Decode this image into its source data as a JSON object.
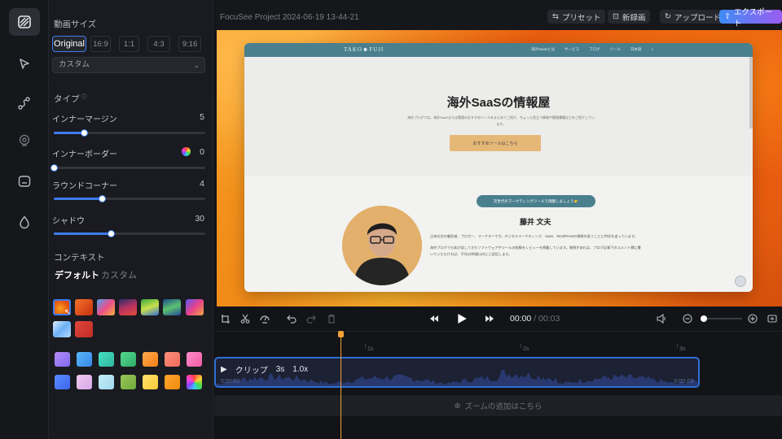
{
  "sidebar": {
    "icons": [
      "gradient-background-icon",
      "cursor-icon",
      "path-motion-icon",
      "camera-icon",
      "caption-icon",
      "drop-icon"
    ]
  },
  "settings": {
    "video_size_title": "動画サイズ",
    "ratios": [
      "Original",
      "16:9",
      "1:1",
      "4:3",
      "9:16"
    ],
    "size_select": "カスタム",
    "type_title": "タイプ",
    "inner_margin": {
      "label": "インナーマージン",
      "value": "5",
      "level": 0.2
    },
    "inner_border": {
      "label": "インナーボーダー",
      "value": "0",
      "level": 0.0
    },
    "round_corner": {
      "label": "ラウンドコーナー",
      "value": "4",
      "level": 0.32
    },
    "shadow": {
      "label": "シャドウ",
      "value": "30",
      "level": 0.38
    },
    "context_title": "コンテキスト",
    "tab_default": "デフォルト",
    "tab_custom": "カスタム"
  },
  "header": {
    "project_title": "FocuSee Project 2024-06-19 13-44-21",
    "preset": "プリセット",
    "new_recording": "新録画",
    "upload": "アップロード",
    "export": "エクスポート"
  },
  "website": {
    "logo": "TAKO☻FUJI",
    "nav": [
      "海外SaaSとは",
      "サービス",
      "ブログ",
      "ツール",
      "日本語"
    ],
    "hero_title": "海外SaaSの情報屋",
    "hero_sub": "海外ブログでは、海外SaaSまたは関連のおすすめツールをまとめてご紹介、ちょっと役立つ情報や関連書籍などをご紹介しています。",
    "hero_button": "おすすめツールはこちら",
    "pill": "次世代のマーケティングツールで飛躍しましょう👉",
    "person_name": "藤井 文夫",
    "bio1": "日本在住の翻訳者、ブロガー、マーケターです。デジタルマーケティング、SaaS、WordPressの情報を扱うことに特化を送っています。",
    "bio2": "海外ブログでも私が試してきたソフトウェアやツールの経験をレビューを掲載しています。質問があれば、ブログ記事下のコメント欄に書いていただければ、平均12時間以内にご返信します。"
  },
  "player": {
    "current_time": "00:00",
    "separator": "/",
    "total_time": "00:03"
  },
  "timeline": {
    "ticks": [
      "1s",
      "2s",
      "3s"
    ],
    "clip_label": "クリップ",
    "clip_duration": "3s",
    "clip_speed": "1.0x",
    "clip_start": "0:00.00",
    "clip_end": "0:00.03",
    "zoom_add": "ズームの追加はこちら"
  },
  "colors": {
    "accent": "#3d7cf0",
    "playhead": "#f2a135",
    "clip_border": "#2f6fd6"
  }
}
